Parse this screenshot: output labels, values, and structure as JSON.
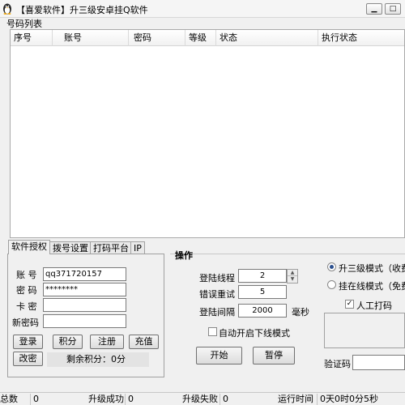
{
  "window": {
    "title": "【喜爱软件】升三级安卓挂Q软件",
    "minimize_glyph": "▁",
    "maximize_glyph": "□"
  },
  "account_list": {
    "label": "号码列表",
    "columns": [
      "序号",
      "账号",
      "密码",
      "等级",
      "状态",
      "执行状态"
    ],
    "rows": []
  },
  "tabs": [
    "软件授权",
    "拨号设置",
    "打码平台",
    "IP"
  ],
  "license": {
    "account_label": "账 号",
    "account_value": "qq371720157",
    "password_label": "密 码",
    "password_value": "********",
    "card_label": "卡 密",
    "card_value": "",
    "new_password_label": "新密码",
    "new_password_value": "",
    "login_button": "登录",
    "points_button": "积分",
    "register_button": "注册",
    "recharge_button": "充值",
    "change_password_button": "改密",
    "remaining_points": "剩余积分：0分"
  },
  "operations": {
    "group_title": "操作",
    "login_threads_label": "登陆线程",
    "login_threads_value": "2",
    "error_retry_label": "错误重试",
    "error_retry_value": "5",
    "login_interval_label": "登陆间隔",
    "login_interval_value": "2000",
    "interval_unit": "毫秒",
    "auto_offline_label": "自动开启下线模式",
    "auto_offline_checked": false,
    "start_button": "开始",
    "pause_button": "暂停"
  },
  "modes": {
    "upgrade_mode_label": "升三级模式（收费",
    "upgrade_mode_selected": true,
    "online_mode_label": "挂在线模式（免费",
    "online_mode_selected": false,
    "manual_captcha_label": "人工打码",
    "manual_captcha_checked": true,
    "captcha_label": "验证码",
    "captcha_value": ""
  },
  "status": {
    "total_label": "总数",
    "total_value": "0",
    "success_label": "升级成功",
    "success_value": "0",
    "failed_label": "升级失败",
    "failed_value": "0",
    "runtime_label": "运行时间",
    "runtime_value": "0天0时0分5秒"
  },
  "icons": {
    "app": "penguin-icon",
    "spin_up": "up-arrow-icon",
    "spin_down": "down-arrow-icon",
    "check": "✓"
  }
}
